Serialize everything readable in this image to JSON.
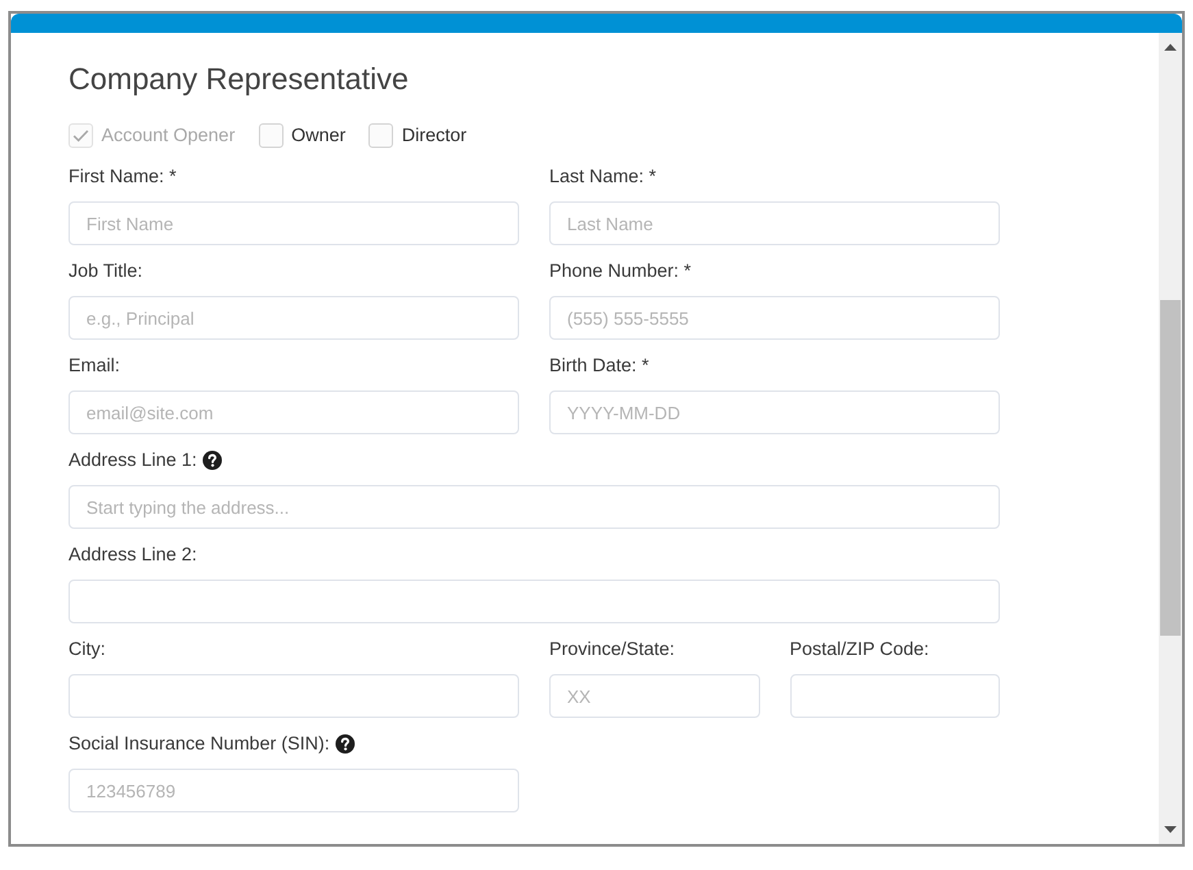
{
  "dialog": {
    "title": "Company Representative",
    "roles": [
      {
        "label": "Account Opener",
        "checked": true,
        "disabled": true
      },
      {
        "label": "Owner",
        "checked": false,
        "disabled": false
      },
      {
        "label": "Director",
        "checked": false,
        "disabled": false
      }
    ],
    "rows": [
      {
        "kind": "columns",
        "fields": [
          {
            "label": "First Name: *",
            "placeholder": "First Name"
          },
          {
            "label": "Last Name: *",
            "placeholder": "Last Name"
          }
        ]
      },
      {
        "kind": "columns",
        "fields": [
          {
            "label": "Job Title:",
            "placeholder": "e.g., Principal"
          },
          {
            "label": "Phone Number: *",
            "placeholder": "(555) 555-5555"
          }
        ]
      },
      {
        "kind": "columns",
        "fields": [
          {
            "label": "Email:",
            "placeholder": "email@site.com"
          },
          {
            "label": "Birth Date: *",
            "placeholder": "YYYY-MM-DD"
          }
        ]
      },
      {
        "kind": "wide",
        "fields": [
          {
            "label": "Address Line 1:",
            "help": true,
            "placeholder": "Start typing the address..."
          }
        ]
      },
      {
        "kind": "wide",
        "fields": [
          {
            "label": "Address Line 2:"
          }
        ]
      },
      {
        "kind": "columns",
        "fields": [
          {
            "label": "City:"
          },
          {
            "label": "Province/State:",
            "placeholder": "XX"
          },
          {
            "label": "Postal/ZIP Code:"
          }
        ]
      },
      {
        "kind": "columns",
        "fields": [
          {
            "label": "Social Insurance Number (SIN):",
            "help": true,
            "placeholder": "123456789"
          }
        ]
      }
    ]
  }
}
